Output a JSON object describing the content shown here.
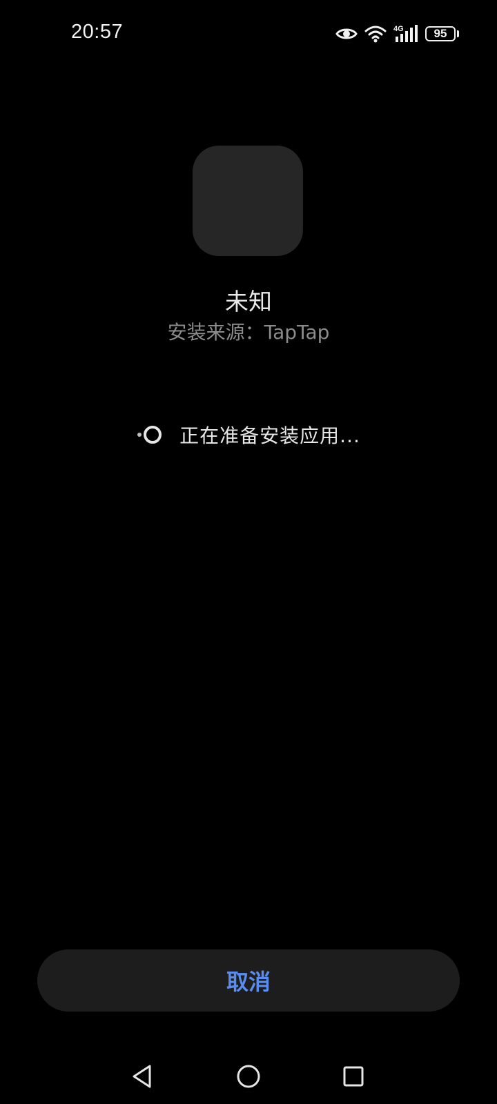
{
  "status_bar": {
    "time": "20:57",
    "icons": [
      "eye-icon",
      "wifi-icon",
      "cellular-4g-icon",
      "battery-icon"
    ],
    "network_label": "4G",
    "battery_level": "95"
  },
  "app": {
    "name": "未知",
    "install_source": "安装来源：TapTap"
  },
  "progress": {
    "text": "正在准备安装应用..."
  },
  "actions": {
    "cancel_label": "取消"
  },
  "nav": {
    "items": [
      "back-icon",
      "home-icon",
      "recents-icon"
    ]
  },
  "colors": {
    "background": "#000000",
    "accent": "#5a8cee",
    "button_bg": "#1d1d1d",
    "icon_placeholder": "#262626"
  }
}
